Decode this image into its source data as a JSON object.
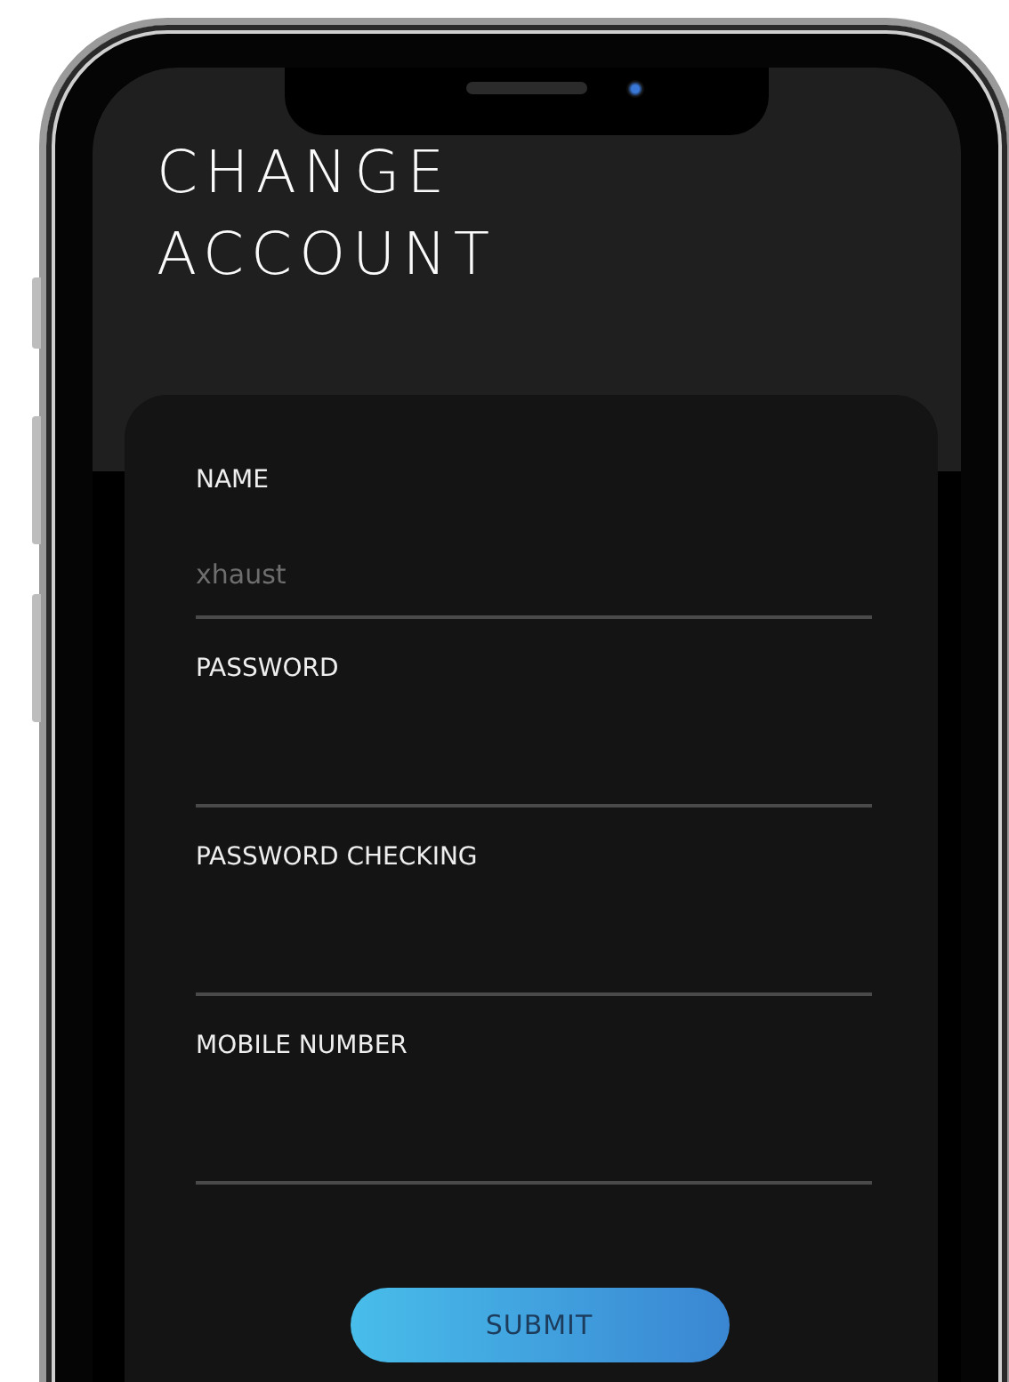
{
  "title": "CHANGE ACCOUNT",
  "fields": [
    {
      "label": "NAME",
      "placeholder": "xhaust"
    },
    {
      "label": "PASSWORD"
    },
    {
      "label": "PASSWORD CHECKING"
    },
    {
      "label": "MOBILE NUMBER"
    }
  ],
  "submit_button": "SUBMIT"
}
